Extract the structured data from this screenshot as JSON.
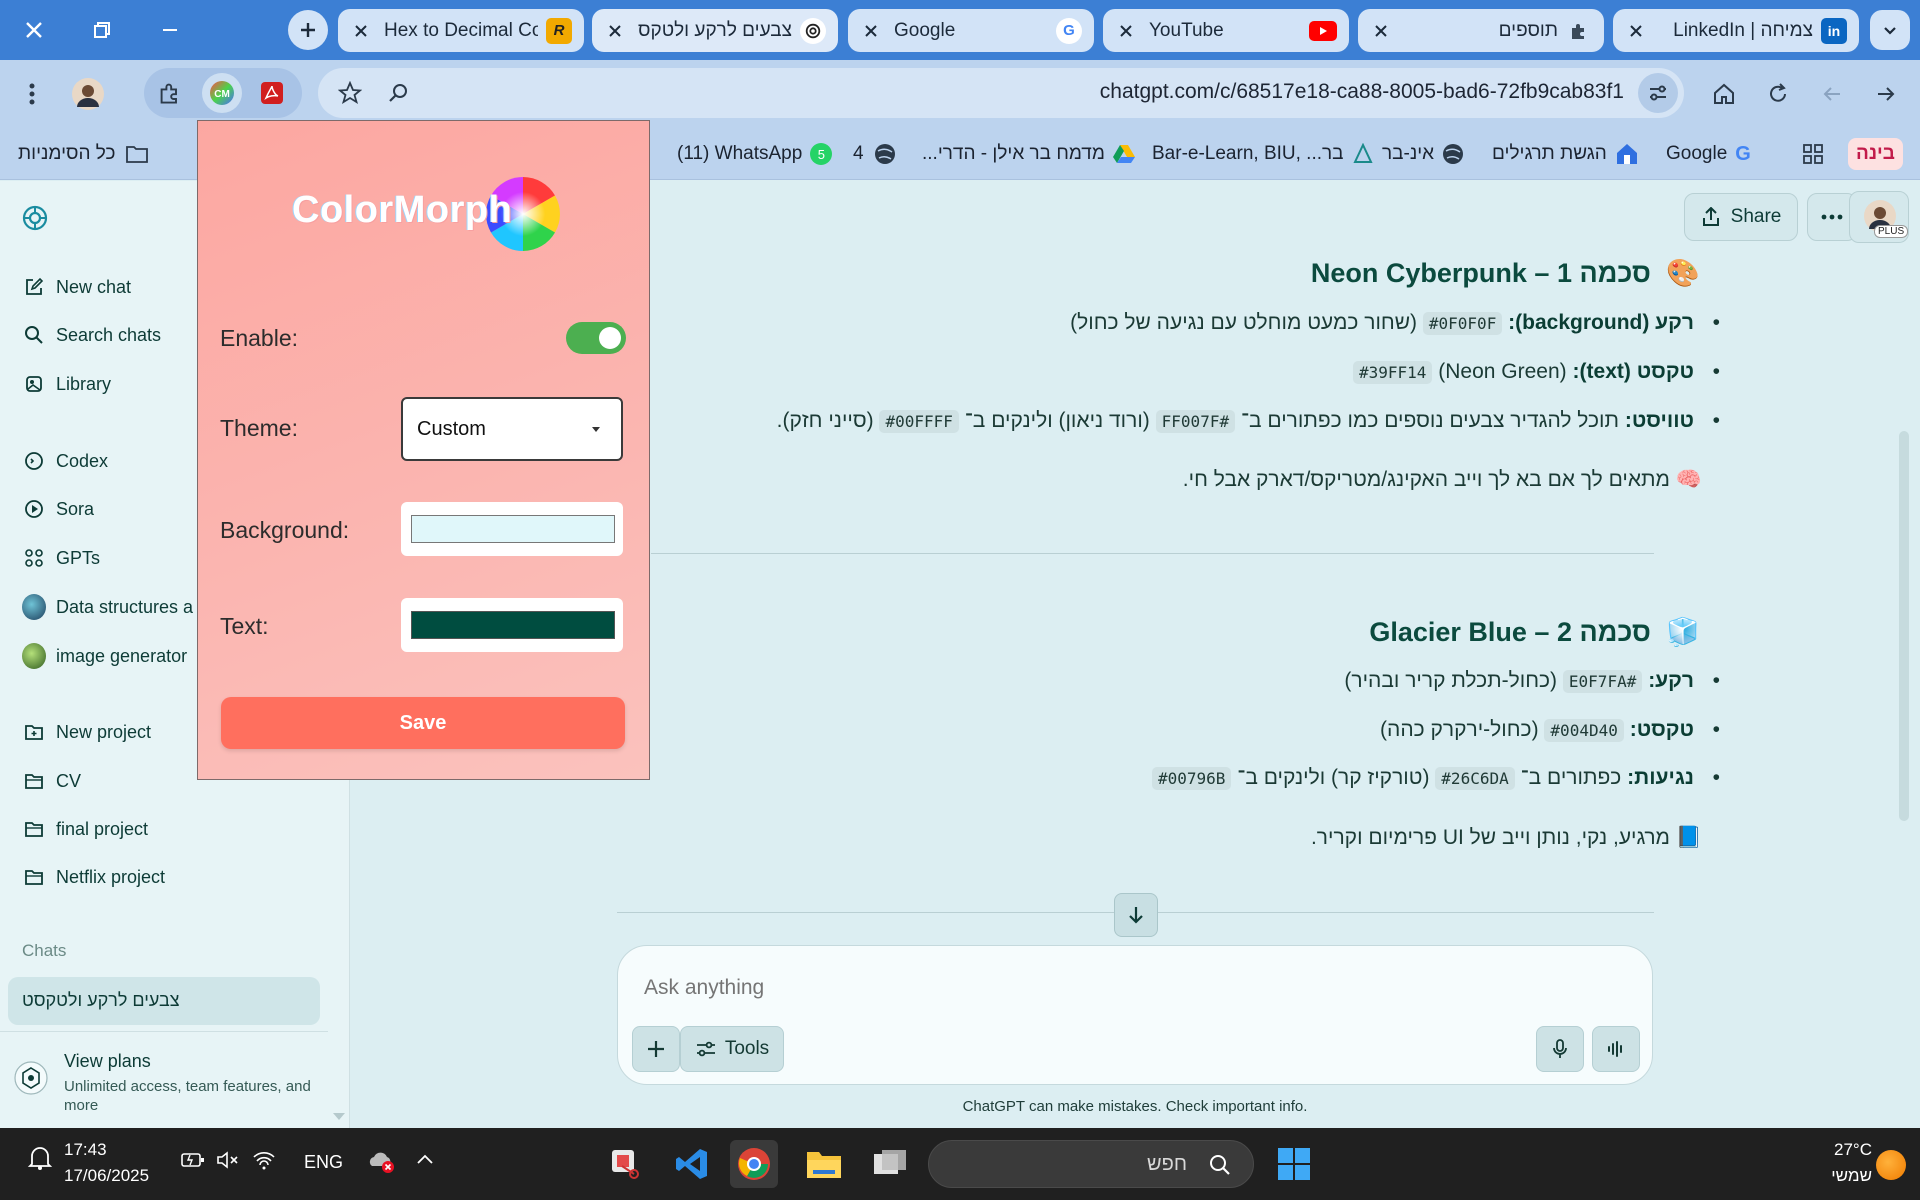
{
  "tabs": [
    {
      "title": "Hex to Decimal Co",
      "favicon": "rapidtables-icon",
      "active": false
    },
    {
      "title": "צבעים לרקע ולטקס",
      "favicon": "chatgpt-icon",
      "active": true
    },
    {
      "title": "Google",
      "favicon": "google-icon",
      "active": false
    },
    {
      "title": "YouTube",
      "favicon": "youtube-icon",
      "active": false
    },
    {
      "title": "תוספים",
      "favicon": "puzzle-icon",
      "active": false
    },
    {
      "title": "צמיחה | LinkedIn",
      "favicon": "linkedin-icon",
      "active": false
    }
  ],
  "omnibox": {
    "url": "chatgpt.com/c/68517e18-ca88-8005-bad6-72fb9cab83f1"
  },
  "bookmarks": {
    "all_bookmarks": "כל הסימניות",
    "items": [
      "(11) WhatsApp",
      "4",
      "מדמח בר אילן - הדרי...",
      "Bar-e-Learn, BIU, ...בר",
      "אינ-בר",
      "הגשת תרגילים",
      "Google"
    ],
    "whatsapp_badge": "5",
    "ai_label": "בינה"
  },
  "sidebar": {
    "items": [
      {
        "label": "New chat",
        "icon": "new-chat-icon"
      },
      {
        "label": "Search chats",
        "icon": "search-icon"
      },
      {
        "label": "Library",
        "icon": "library-icon"
      },
      {
        "label": "Codex",
        "icon": "codex-icon"
      },
      {
        "label": "Sora",
        "icon": "sora-icon"
      },
      {
        "label": "GPTs",
        "icon": "gpts-icon"
      },
      {
        "label": "Data structures a",
        "icon": "avatar-icon"
      },
      {
        "label": "image generator",
        "icon": "avatar-icon"
      },
      {
        "label": "New project",
        "icon": "new-project-icon"
      },
      {
        "label": "CV",
        "icon": "folder-icon"
      },
      {
        "label": "final project",
        "icon": "folder-icon"
      },
      {
        "label": "Netflix project",
        "icon": "folder-icon"
      }
    ],
    "chats_heading": "Chats",
    "active_chat": "צבעים לרקע ולטקסט",
    "view_plans": "View plans",
    "view_plans_sub": "Unlimited access, team features, and more"
  },
  "header": {
    "share": "Share",
    "plus_badge": "PLUS"
  },
  "content": {
    "scheme1_title": "סכמה 1 – Neon Cyberpunk",
    "scheme1_icon": "🎨",
    "s1_bg_label": "רקע (background):",
    "s1_bg_code": "#0F0F0F",
    "s1_bg_desc": "(שחור כמעט מוחלט עם נגיעה של כחול)",
    "s1_text_label": "טקסט (text):",
    "s1_text_desc": "(Neon Green)",
    "s1_text_code": "#39FF14",
    "s1_twist_label": "טוויסט:",
    "s1_twist_a": "תוכל להגדיר צבעים נוספים כמו כפתורים ב־",
    "s1_twist_code1": "#FF007F",
    "s1_twist_b": "(ורוד ניאון) ולינקים ב־",
    "s1_twist_code2": "#00FFFF",
    "s1_twist_c": "(סייני חזק).",
    "s1_note": "מתאים לך אם בא לך וייב האקינג/מטריקס/דארק אבל חי.",
    "s1_note_icon": "🧠",
    "scheme2_title": "סכמה 2 – Glacier Blue",
    "scheme2_icon": "🧊",
    "s2_bg_label": "רקע:",
    "s2_bg_code": "#E0F7FA",
    "s2_bg_desc": "(כחול-תכלת קריר ובהיר)",
    "s2_text_label": "טקסט:",
    "s2_text_code": "#004D40",
    "s2_text_desc": "(כחול-ירקרק כהה)",
    "s2_acc_label": "נגיעות:",
    "s2_acc_a": "כפתורים ב־",
    "s2_acc_code1": "#26C6DA",
    "s2_acc_b": "(טורקיז קר) ולינקים ב־",
    "s2_acc_code2": "#00796B",
    "s2_note": "מרגיע, נקי, נותן וייב של UI פרימיום וקריר.",
    "s2_note_icon": "📘"
  },
  "composer": {
    "placeholder": "Ask anything",
    "tools": "Tools",
    "disclaimer": "ChatGPT can make mistakes. Check important info."
  },
  "popup": {
    "logo_text": "ColorMorph",
    "enable_label": "Enable:",
    "enabled": true,
    "theme_label": "Theme:",
    "theme_value": "Custom",
    "background_label": "Background:",
    "background_color": "#E0F7FA",
    "text_label": "Text:",
    "text_color": "#004D40",
    "save": "Save"
  },
  "taskbar": {
    "time": "17:43",
    "date": "17/06/2025",
    "lang": "ENG",
    "search_placeholder": "חפש",
    "temp": "27°C",
    "weather": "שמשי"
  },
  "colors": {
    "tabbar": "#3c7fd4",
    "accent_green": "#0b4a3e",
    "save_button": "#ff6f5e",
    "toggle_on": "#4caf50"
  }
}
